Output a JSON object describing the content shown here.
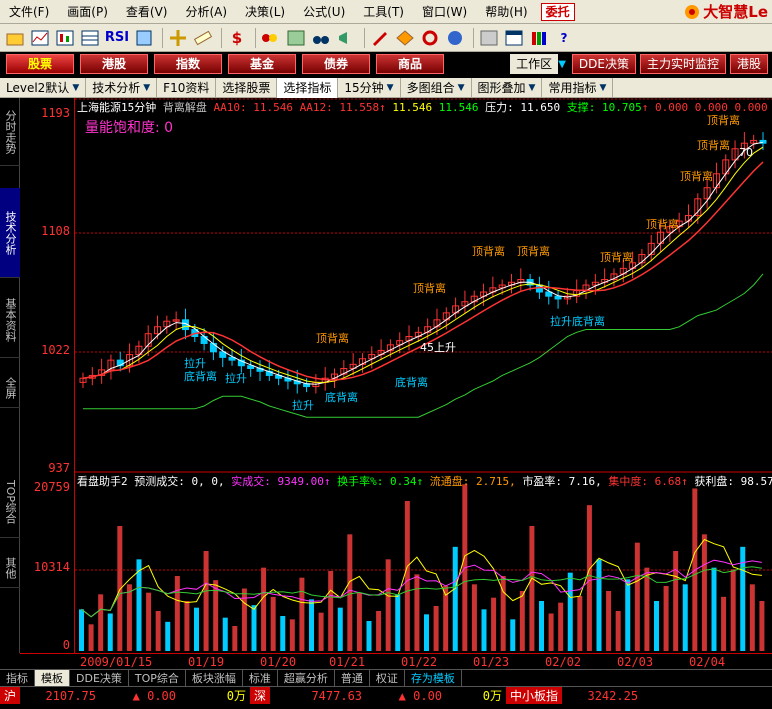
{
  "menu": {
    "items": [
      "文件(F)",
      "画面(P)",
      "查看(V)",
      "分析(A)",
      "决策(L)",
      "公式(U)",
      "工具(T)",
      "窗口(W)",
      "帮助(H)"
    ],
    "weituo": "委托",
    "brand": "大智慧Le"
  },
  "toolbar": {
    "rsi": "RSI",
    "dollar": "$"
  },
  "markets": [
    "股票",
    "港股",
    "指数",
    "基金",
    "债券",
    "商品"
  ],
  "market_right": {
    "workarea": "工作区",
    "dde": "DDE决策",
    "monitor": "主力实时监控",
    "hk": "港股"
  },
  "tabs": [
    "Level2默认",
    "技术分析",
    "F10资料",
    "选择股票",
    "选择指标",
    "15分钟",
    "多图组合",
    "图形叠加",
    "常用指标"
  ],
  "sidebar": [
    "分时走势",
    "技术分析",
    "基本资料",
    "全屏",
    "TOP综合",
    "其他"
  ],
  "main_panel": {
    "stock": "上海能源15分钟",
    "indicator": "背离解盘",
    "aa10_label": "AA10:",
    "aa10": "11.546",
    "aa12_label": "AA12:",
    "aa12": "11.558",
    "v3": "11.546",
    "v4": "11.546",
    "pressure_label": "压力:",
    "pressure": "11.650",
    "support_label": "支撑:",
    "support": "10.705",
    "z1": "0.000",
    "z2": "0.000",
    "z3": "0.000",
    "saturation": "量能饱和度: 0",
    "y_labels": [
      "1193",
      "1108",
      "1022",
      "937"
    ]
  },
  "vol_panel": {
    "name": "看盘助手2",
    "pred_label": "预测成交:",
    "pred": "0,",
    "pred2": "0,",
    "real_label": "实成交:",
    "real": "9349.00",
    "turnover_label": "换手率%:",
    "turnover": "0.34",
    "float_label": "流通盘:",
    "float": "2.715,",
    "pe_label": "市盈率:",
    "pe": "7.16,",
    "conc_label": "集中度:",
    "conc": "6.68",
    "profit_label": "获利盘:",
    "profit": "98.57",
    "y_labels": [
      "20759",
      "10314",
      "0"
    ]
  },
  "annotations": {
    "top_div": "顶背离",
    "bottom_div": "底背离",
    "pull_up": "拉升",
    "rise45": "45上升",
    "seventy": "70"
  },
  "xaxis": {
    "period": "15分钟",
    "dates": [
      "2009/01/15",
      "01/19",
      "01/20",
      "01/21",
      "01/22",
      "01/23",
      "02/02",
      "02/03",
      "02/04"
    ]
  },
  "bottom_tabs": [
    "指标",
    "模板",
    "DDE决策",
    "TOP综合",
    "板块涨幅",
    "标准",
    "超赢分析",
    "普通",
    "权证",
    "存为模板"
  ],
  "status": {
    "sh": "沪",
    "sh_val": "2107.75",
    "sh_chg": "▲ 0.00",
    "sh_vol": "0万",
    "sz": "深",
    "sz_val": "7477.63",
    "sz_chg": "▲ 0.00",
    "sz_vol": "0万",
    "zx": "中小板指",
    "zx_val": "3242.25"
  },
  "chart_data": [
    {
      "type": "candlestick",
      "title": "上海能源15分钟",
      "ylim": [
        937,
        1193
      ],
      "support_line": [
        10.705
      ],
      "pressure_line": [
        11.65
      ],
      "close_series": [
        1003,
        1005,
        1009,
        1016,
        1012,
        1020,
        1026,
        1035,
        1040,
        1044,
        1045,
        1038,
        1033,
        1028,
        1022,
        1018,
        1016,
        1012,
        1010,
        1008,
        1005,
        1003,
        1001,
        999,
        997,
        1000,
        1003,
        1006,
        1010,
        1013,
        1017,
        1020,
        1023,
        1027,
        1030,
        1033,
        1036,
        1040,
        1045,
        1050,
        1055,
        1058,
        1062,
        1065,
        1068,
        1070,
        1072,
        1074,
        1070,
        1065,
        1062,
        1060,
        1062,
        1066,
        1070,
        1072,
        1074,
        1078,
        1082,
        1086,
        1092,
        1100,
        1108,
        1112,
        1116,
        1120,
        1132,
        1140,
        1150,
        1160,
        1168,
        1172,
        1174,
        1172
      ]
    },
    {
      "type": "bar",
      "title": "看盘助手2",
      "ylim": [
        0,
        20759
      ],
      "values": [
        5000,
        3200,
        6800,
        4500,
        15000,
        8000,
        11000,
        7000,
        4800,
        3500,
        9000,
        6000,
        5200,
        12000,
        8500,
        4000,
        3000,
        7500,
        5500,
        10000,
        6500,
        4200,
        3800,
        8800,
        6200,
        4600,
        9600,
        5200,
        14000,
        7000,
        3600,
        4800,
        11000,
        6800,
        18000,
        9200,
        4400,
        5400,
        7800,
        12500,
        20000,
        8000,
        5000,
        6400,
        9000,
        3800,
        7200,
        15000,
        6000,
        4500,
        5800,
        9400,
        6600,
        17500,
        11000,
        7200,
        4800,
        8600,
        13000,
        10000,
        6000,
        7800,
        12000,
        8000,
        19500,
        14000,
        10000,
        6500,
        9800,
        12500,
        8000,
        6000
      ]
    }
  ]
}
